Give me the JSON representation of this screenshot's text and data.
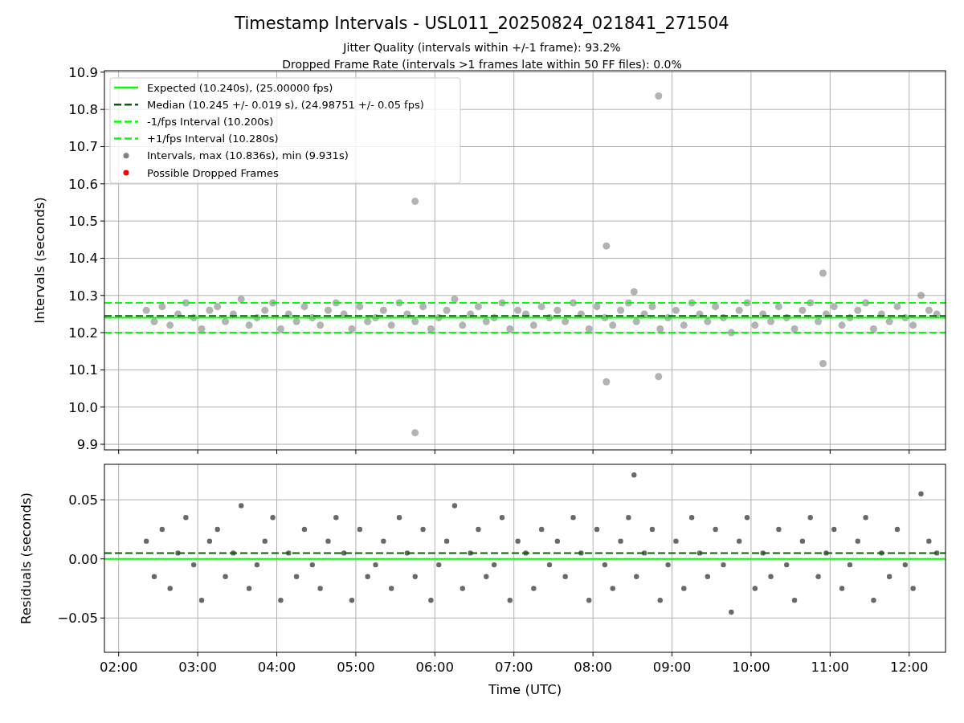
{
  "figure": {
    "title": "Timestamp Intervals - USL011_20250824_021841_271504",
    "subtitles": [
      "Jitter Quality (intervals within +/-1 frame): 93.2%",
      "Dropped Frame Rate (intervals >1 frames late within 50 FF files): 0.0%"
    ],
    "intervals_panel": {
      "chart_data": {
        "type": "scatter",
        "ylabel": "Intervals (seconds)",
        "xlim": [
          1.82,
          12.46
        ],
        "ylim": [
          9.885,
          10.904
        ],
        "legend": true,
        "grid": true,
        "yticks": [
          {
            "value": 9.9,
            "label": "9.9"
          },
          {
            "value": 10.0,
            "label": "10.0"
          },
          {
            "value": 10.1,
            "label": "10.1"
          },
          {
            "value": 10.2,
            "label": "10.2"
          },
          {
            "value": 10.3,
            "label": "10.3"
          },
          {
            "value": 10.4,
            "label": "10.4"
          },
          {
            "value": 10.5,
            "label": "10.5"
          },
          {
            "value": 10.6,
            "label": "10.6"
          },
          {
            "value": 10.7,
            "label": "10.7"
          },
          {
            "value": 10.8,
            "label": "10.8"
          },
          {
            "value": 10.9,
            "label": "10.9"
          }
        ],
        "x": [
          2.35,
          2.45,
          2.55,
          2.65,
          2.75,
          2.85,
          2.95,
          3.05,
          3.15,
          3.25,
          3.35,
          3.45,
          3.55,
          3.65,
          3.75,
          3.85,
          3.95,
          4.05,
          4.15,
          4.25,
          4.35,
          4.45,
          4.55,
          4.65,
          4.75,
          4.85,
          4.95,
          5.05,
          5.15,
          5.25,
          5.35,
          5.45,
          5.55,
          5.65,
          5.75,
          5.85,
          5.95,
          6.05,
          6.15,
          6.25,
          6.35,
          6.45,
          6.55,
          6.65,
          6.75,
          6.85,
          6.95,
          7.05,
          7.15,
          7.25,
          7.35,
          7.45,
          7.55,
          7.65,
          7.75,
          7.85,
          7.95,
          8.05,
          8.15,
          8.25,
          8.35,
          8.45,
          8.55,
          8.65,
          8.75,
          8.85,
          8.95,
          9.05,
          9.15,
          9.25,
          9.35,
          9.45,
          9.55,
          9.65,
          9.75,
          9.85,
          9.95,
          10.05,
          10.15,
          10.25,
          10.35,
          10.45,
          10.55,
          10.65,
          10.75,
          10.85,
          10.95,
          11.05,
          11.15,
          11.25,
          11.35,
          11.45,
          11.55,
          11.65,
          11.75,
          11.85,
          11.95,
          12.05,
          12.15,
          12.25,
          12.35,
          5.75,
          5.75,
          8.17,
          8.17,
          8.83,
          8.83,
          8.52,
          10.91,
          10.91
        ],
        "series": [
          {
            "name": "Intervals, max (10.836s), min (9.931s)",
            "color": "#808080",
            "values": [
              10.26,
              10.23,
              10.27,
              10.22,
              10.25,
              10.28,
              10.24,
              10.21,
              10.26,
              10.27,
              10.23,
              10.25,
              10.29,
              10.22,
              10.24,
              10.26,
              10.28,
              10.21,
              10.25,
              10.23,
              10.27,
              10.24,
              10.22,
              10.26,
              10.28,
              10.25,
              10.21,
              10.27,
              10.23,
              10.24,
              10.26,
              10.22,
              10.28,
              10.25,
              10.23,
              10.27,
              10.21,
              10.24,
              10.26,
              10.29,
              10.22,
              10.25,
              10.27,
              10.23,
              10.24,
              10.28,
              10.21,
              10.26,
              10.25,
              10.22,
              10.27,
              10.24,
              10.26,
              10.23,
              10.28,
              10.25,
              10.21,
              10.27,
              10.24,
              10.22,
              10.26,
              10.28,
              10.23,
              10.25,
              10.27,
              10.21,
              10.24,
              10.26,
              10.22,
              10.28,
              10.25,
              10.23,
              10.27,
              10.24,
              10.2,
              10.26,
              10.28,
              10.22,
              10.25,
              10.23,
              10.27,
              10.24,
              10.21,
              10.26,
              10.28,
              10.23,
              10.25,
              10.27,
              10.22,
              10.24,
              10.26,
              10.28,
              10.21,
              10.25,
              10.23,
              10.27,
              10.24,
              10.22,
              10.3,
              10.26,
              10.25,
              10.553,
              9.931,
              10.433,
              10.068,
              10.836,
              10.082,
              10.31,
              10.36,
              10.117
            ]
          },
          {
            "name": "Possible Dropped Frames",
            "color": "#ff0000",
            "values": [
              null,
              null,
              null,
              null,
              null,
              null,
              null,
              null,
              null,
              null,
              null,
              null,
              null,
              null,
              null,
              null,
              null,
              null,
              null,
              null,
              null,
              null,
              null,
              null,
              null,
              null,
              null,
              null,
              null,
              null,
              null,
              null,
              null,
              null,
              null,
              null,
              null,
              null,
              null,
              null,
              null,
              null,
              null,
              null,
              null,
              null,
              null,
              null,
              null,
              null,
              null,
              null,
              null,
              null,
              null,
              null,
              null,
              null,
              null,
              null,
              null,
              null,
              null,
              null,
              null,
              null,
              null,
              null,
              null,
              null,
              null,
              null,
              null,
              null,
              null,
              null,
              null,
              null,
              null,
              null,
              null,
              null,
              null,
              null,
              null,
              null,
              null,
              null,
              null,
              null,
              null,
              null,
              null,
              null,
              null,
              null,
              null,
              null,
              null,
              null,
              null,
              null,
              null,
              null,
              null,
              null,
              null,
              null,
              null,
              null
            ]
          }
        ],
        "ref_lines": [
          {
            "axis": "y",
            "label": "Expected (10.240s), (25.00000 fps)",
            "value": 10.24,
            "color": "#00ff00"
          },
          {
            "axis": "y",
            "label": "Median (10.245 +/- 0.019 s), (24.98751 +/- 0.05 fps)",
            "value": 10.245,
            "color": "#006400"
          },
          {
            "axis": "y",
            "label": "-1/fps Interval (10.200s)",
            "value": 10.2,
            "color": "#00ff00"
          },
          {
            "axis": "y",
            "label": "+1/fps Interval (10.280s)",
            "value": 10.28,
            "color": "#00ff00"
          }
        ]
      }
    },
    "residuals_panel": {
      "chart_data": {
        "type": "scatter",
        "xlabel": "Time (UTC)",
        "ylabel": "Residuals (seconds)",
        "xlim": [
          1.82,
          12.46
        ],
        "ylim": [
          -0.079,
          0.08
        ],
        "grid": true,
        "xticks": [
          {
            "value": 2,
            "label": "02:00"
          },
          {
            "value": 3,
            "label": "03:00"
          },
          {
            "value": 4,
            "label": "04:00"
          },
          {
            "value": 5,
            "label": "05:00"
          },
          {
            "value": 6,
            "label": "06:00"
          },
          {
            "value": 7,
            "label": "07:00"
          },
          {
            "value": 8,
            "label": "08:00"
          },
          {
            "value": 9,
            "label": "09:00"
          },
          {
            "value": 10,
            "label": "10:00"
          },
          {
            "value": 11,
            "label": "11:00"
          },
          {
            "value": 12,
            "label": "12:00"
          }
        ],
        "yticks": [
          {
            "value": -0.05,
            "label": "−0.05"
          },
          {
            "value": 0,
            "label": "0.00"
          },
          {
            "value": 0.05,
            "label": "0.05"
          }
        ],
        "x": [
          2.35,
          2.45,
          2.55,
          2.65,
          2.75,
          2.85,
          2.95,
          3.05,
          3.15,
          3.25,
          3.35,
          3.45,
          3.55,
          3.65,
          3.75,
          3.85,
          3.95,
          4.05,
          4.15,
          4.25,
          4.35,
          4.45,
          4.55,
          4.65,
          4.75,
          4.85,
          4.95,
          5.05,
          5.15,
          5.25,
          5.35,
          5.45,
          5.55,
          5.65,
          5.75,
          5.85,
          5.95,
          6.05,
          6.15,
          6.25,
          6.35,
          6.45,
          6.55,
          6.65,
          6.75,
          6.85,
          6.95,
          7.05,
          7.15,
          7.25,
          7.35,
          7.45,
          7.55,
          7.65,
          7.75,
          7.85,
          7.95,
          8.05,
          8.15,
          8.25,
          8.35,
          8.45,
          8.55,
          8.65,
          8.75,
          8.85,
          8.95,
          9.05,
          9.15,
          9.25,
          9.35,
          9.45,
          9.55,
          9.65,
          9.75,
          9.85,
          9.95,
          10.05,
          10.15,
          10.25,
          10.35,
          10.45,
          10.55,
          10.65,
          10.75,
          10.85,
          10.95,
          11.05,
          11.15,
          11.25,
          11.35,
          11.45,
          11.55,
          11.65,
          11.75,
          11.85,
          11.95,
          12.05,
          12.15,
          12.25,
          12.35,
          8.52
        ],
        "series": [
          {
            "color": "#696969",
            "values": [
              0.015,
              -0.015,
              0.025,
              -0.025,
              0.005,
              0.035,
              -0.005,
              -0.035,
              0.015,
              0.025,
              -0.015,
              0.005,
              0.045,
              -0.025,
              -0.005,
              0.015,
              0.035,
              -0.035,
              0.005,
              -0.015,
              0.025,
              -0.005,
              -0.025,
              0.015,
              0.035,
              0.005,
              -0.035,
              0.025,
              -0.015,
              -0.005,
              0.015,
              -0.025,
              0.035,
              0.005,
              -0.015,
              0.025,
              -0.035,
              -0.005,
              0.015,
              0.045,
              -0.025,
              0.005,
              0.025,
              -0.015,
              -0.005,
              0.035,
              -0.035,
              0.015,
              0.005,
              -0.025,
              0.025,
              -0.005,
              0.015,
              -0.015,
              0.035,
              0.005,
              -0.035,
              0.025,
              -0.005,
              -0.025,
              0.015,
              0.035,
              -0.015,
              0.005,
              0.025,
              -0.035,
              -0.005,
              0.015,
              -0.025,
              0.035,
              0.005,
              -0.015,
              0.025,
              -0.005,
              -0.045,
              0.015,
              0.035,
              -0.025,
              0.005,
              -0.015,
              0.025,
              -0.005,
              -0.035,
              0.015,
              0.035,
              -0.015,
              0.005,
              0.025,
              -0.025,
              -0.005,
              0.015,
              0.035,
              -0.035,
              0.005,
              -0.015,
              0.025,
              -0.005,
              -0.025,
              0.055,
              0.015,
              0.005,
              0.071
            ]
          }
        ],
        "ref_lines": [
          {
            "axis": "y",
            "value": 0,
            "color": "#00ff00"
          },
          {
            "axis": "y",
            "value": 0.005,
            "color": "#006400"
          }
        ]
      }
    }
  }
}
